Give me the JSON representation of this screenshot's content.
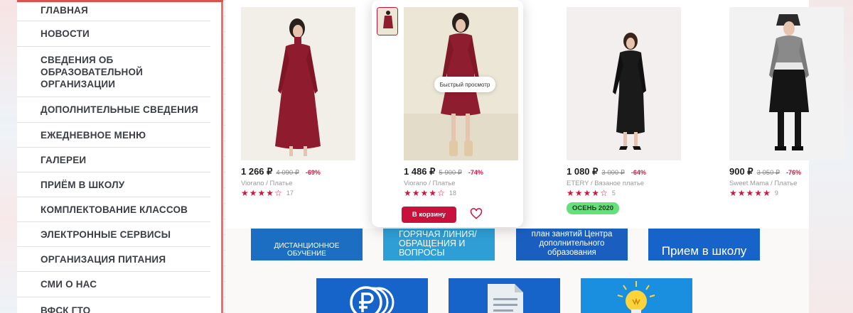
{
  "menu": {
    "items": [
      "ГЛАВНАЯ",
      "НОВОСТИ",
      "СВЕДЕНИЯ ОБ ОБРАЗОВАТЕЛЬНОЙ ОРГАНИЗАЦИИ",
      "ДОПОЛНИТЕЛЬНЫЕ СВЕДЕНИЯ",
      "ЕЖЕДНЕВНОЕ МЕНЮ",
      "ГАЛЕРЕИ",
      "ПРИЁМ В ШКОЛУ",
      "КОМПЛЕКТОВАНИЕ КЛАССОВ",
      "ЭЛЕКТРОННЫЕ СЕРВИСЫ",
      "ОРГАНИЗАЦИЯ ПИТАНИЯ",
      "СМИ О НАС",
      "ВФСК ГТО"
    ]
  },
  "products": [
    {
      "price": "1 266 ₽",
      "old_price": "4 090 ₽",
      "discount": "-69%",
      "brand_line": "Viorano / Платье",
      "rating": 4,
      "reviews": "17",
      "dress_color": "#8e1c2e",
      "photo_bg": "#f2efe9"
    },
    {
      "price": "1 486 ₽",
      "old_price": "5 900 ₽",
      "discount": "-74%",
      "brand_line": "Viorano / Платье",
      "rating": 4,
      "reviews": "18",
      "dress_color": "#8f1d30",
      "photo_bg": "#ebe6d6",
      "quick_view": "Быстрый просмотр",
      "cart_button": "В корзину"
    },
    {
      "price": "1 080 ₽",
      "old_price": "3 000 ₽",
      "discount": "-64%",
      "brand_line": "ETERY / Вязаное платье",
      "rating": 4,
      "reviews": "5",
      "badge": "ОСЕНЬ 2020",
      "dress_color": "#1a1a1a",
      "photo_bg": "#f3efee"
    },
    {
      "price": "900 ₽",
      "old_price": "3 050 ₽",
      "discount": "-76%",
      "brand_line": "Sweet Mama / Платье",
      "rating": 5,
      "reviews": "9",
      "dress_color": "#151515",
      "photo_bg": "#f2f2f2"
    }
  ],
  "tiles": {
    "row1": [
      "ДИСТАНЦИОННОЕ ОБУЧЕНИЕ",
      "ГОРЯЧАЯ ЛИНИЯ/ ОБРАЩЕНИЯ И ВОПРОСЫ",
      "план занятий Центра дополнительного образования",
      "Прием в школу"
    ]
  },
  "colors": {
    "accent_red": "#c8123b",
    "menu_border": "#ef6f6f",
    "tile_blue": "#1b6ec2",
    "tile_cyan": "#2e9fd6",
    "badge_green": "#66e07a"
  }
}
